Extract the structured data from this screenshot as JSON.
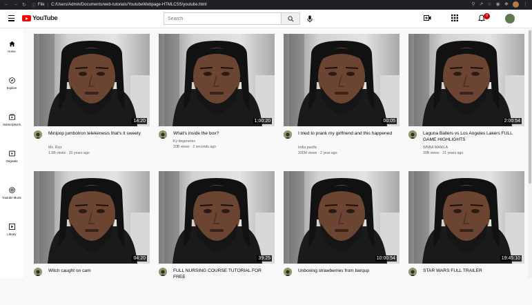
{
  "browser": {
    "info_label": "File",
    "url": "C:/Users/Admin/Documents/web-tutorials/YoutubeWebpage-HTMLCSS/youtube.html"
  },
  "header": {
    "logo_text": "YouTube",
    "search_placeholder": "Search",
    "notification_count": "9"
  },
  "sidebar": {
    "items": [
      {
        "label": "Home",
        "icon": "home-icon"
      },
      {
        "label": "Explore",
        "icon": "compass-icon"
      },
      {
        "label": "Subscriptions",
        "icon": "subscriptions-icon"
      },
      {
        "label": "Originals",
        "icon": "originals-icon"
      },
      {
        "label": "Youtube Music",
        "icon": "music-icon"
      },
      {
        "label": "Library",
        "icon": "library-icon"
      }
    ]
  },
  "videos": [
    {
      "title": "Minipop jumbotron telekenesis that's it sweety",
      "channel": "Ms. Rizz",
      "views": "1.5B views",
      "age": "20 years ago",
      "duration": "14:20"
    },
    {
      "title": "What's inside the box?",
      "channel": "Ky degeneres",
      "views": "20B views",
      "age": "2 seconds ago",
      "duration": "1:00:20"
    },
    {
      "title": "I tried to prank my girlfriend and this happened",
      "channel": "India pacific",
      "views": "200M views",
      "age": "2 year ago",
      "duration": "00:05"
    },
    {
      "title": "Laguna Ballers vs Los Angeles Lakers FULL GAME HIGHLIGHTS",
      "channel": "WNBA MANILA",
      "views": "30B views",
      "age": "21 years ago",
      "duration": "2:00:54"
    },
    {
      "title": "Witch caught on cam",
      "channel": "",
      "views": "",
      "age": "",
      "duration": "04:20"
    },
    {
      "title": "FULL NURSING COURSE TUTORIAL FOR FREE",
      "channel": "",
      "views": "",
      "age": "",
      "duration": "39:25"
    },
    {
      "title": "Unboxing strawberries from barqup",
      "channel": "",
      "views": "",
      "age": "",
      "duration": "10:00:54"
    },
    {
      "title": "STAR WARS FULL TRAILER",
      "channel": "",
      "views": "",
      "age": "",
      "duration": "19:45:10"
    }
  ]
}
